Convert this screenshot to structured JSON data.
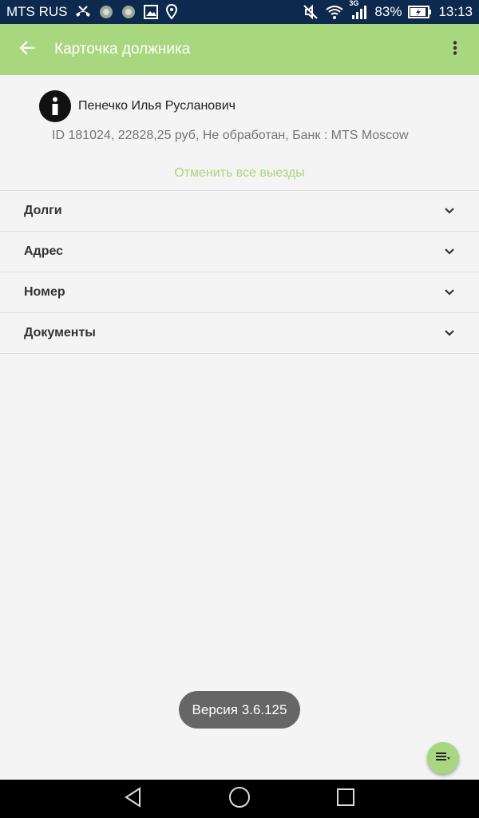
{
  "status_bar": {
    "carrier": "MTS RUS",
    "network_type": "3G",
    "battery": "83%",
    "time": "13:13",
    "left_icons": [
      "missed-call-icon",
      "app-icon-1",
      "app-icon-2",
      "image-icon",
      "location-icon"
    ],
    "right_icons": [
      "mute-icon",
      "wifi-icon",
      "signal-icon",
      "battery-charging-icon"
    ]
  },
  "app_bar": {
    "title": "Карточка должника",
    "color": "#a8d77f"
  },
  "debtor": {
    "name": "Пенечко Илья Русланович",
    "details": "ID 181024, 22828,25 руб, Не обработан, Банк : MTS Moscow",
    "cancel_all_visits": "Отменить все выезды"
  },
  "sections": [
    {
      "label": "Долги"
    },
    {
      "label": "Адрес"
    },
    {
      "label": "Номер"
    },
    {
      "label": "Документы"
    }
  ],
  "toast": {
    "text": "Версия 3.6.125"
  },
  "colors": {
    "accent": "#a8d77f",
    "status_bar": "#0d2a4e",
    "background": "#f4f4f4"
  }
}
